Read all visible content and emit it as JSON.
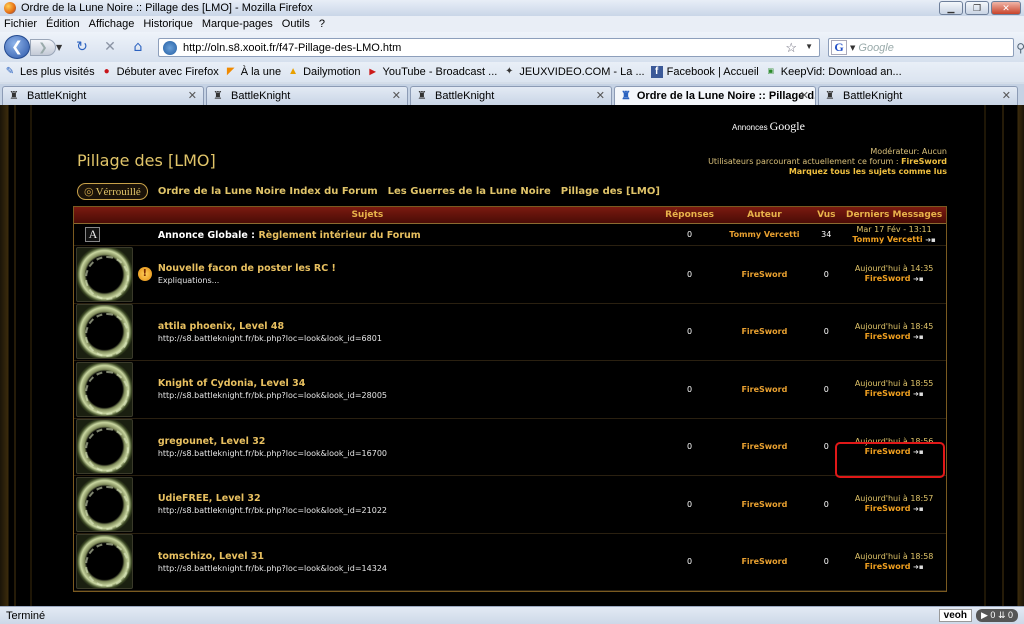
{
  "window": {
    "title": "Ordre de la Lune Noire :: Pillage des [LMO] - Mozilla Firefox"
  },
  "menu": [
    "Fichier",
    "Édition",
    "Affichage",
    "Historique",
    "Marque-pages",
    "Outils",
    "?"
  ],
  "nav": {
    "url": "http://oln.s8.xooit.fr/f47-Pillage-des-LMO.htm",
    "search_placeholder": "Google"
  },
  "bookmarks": [
    {
      "label": "Les plus visités",
      "icon": "most-visited-icon"
    },
    {
      "label": "Débuter avec Firefox",
      "icon": "firefox-icon"
    },
    {
      "label": "À la une",
      "icon": "rss-icon"
    },
    {
      "label": "Dailymotion",
      "icon": "dailymotion-icon"
    },
    {
      "label": "YouTube - Broadcast ...",
      "icon": "youtube-icon"
    },
    {
      "label": "JEUXVIDEO.COM - La ...",
      "icon": "jeuxvideo-icon"
    },
    {
      "label": "Facebook | Accueil",
      "icon": "facebook-icon"
    },
    {
      "label": "KeepVid: Download an...",
      "icon": "keepvid-icon"
    }
  ],
  "tabs": [
    {
      "label": "BattleKnight",
      "active": false
    },
    {
      "label": "BattleKnight",
      "active": false
    },
    {
      "label": "BattleKnight",
      "active": false
    },
    {
      "label": "Ordre de la Lune Noire :: Pillage d...",
      "active": true
    },
    {
      "label": "BattleKnight",
      "active": false
    }
  ],
  "page": {
    "ads_label": "Annonces",
    "ads_brand": "Google",
    "forum_title": "Pillage des [LMO]",
    "moderator": "Modérateur: Aucun",
    "users_browsing_label": "Utilisateurs parcourant actuellement ce forum :",
    "users_browsing_name": "FireSword",
    "mark_read": "Marquez tous les sujets comme lus",
    "locked_label": "Vérrouillé",
    "breadcrumbs": [
      "Ordre de la Lune Noire Index du Forum",
      "Les Guerres de la Lune Noire",
      "Pillage des [LMO]"
    ],
    "columns": {
      "subjects": "Sujets",
      "replies": "Réponses",
      "author": "Auteur",
      "views": "Vus",
      "last": "Derniers Messages"
    },
    "announcement": {
      "label": "Annonce Globale :",
      "title": "Règlement intérieur du Forum",
      "replies": "0",
      "author": "Tommy Vercetti",
      "views": "34",
      "last_date": "Mar 17 Fév - 13:11",
      "last_by": "Tommy Vercetti"
    },
    "topics": [
      {
        "title": "Nouvelle facon de poster les RC !",
        "sub": "Expliquations...",
        "replies": "0",
        "author": "FireSword",
        "views": "0",
        "last_date": "Aujourd'hui à 14:35",
        "last_by": "FireSword"
      },
      {
        "title": "attila phoenix, Level 48",
        "sub": "http://s8.battleknight.fr/bk.php?loc=look&look_id=6801",
        "replies": "0",
        "author": "FireSword",
        "views": "0",
        "last_date": "Aujourd'hui à 18:45",
        "last_by": "FireSword"
      },
      {
        "title": "Knight of Cydonia, Level 34",
        "sub": "http://s8.battleknight.fr/bk.php?loc=look&look_id=28005",
        "replies": "0",
        "author": "FireSword",
        "views": "0",
        "last_date": "Aujourd'hui à 18:55",
        "last_by": "FireSword"
      },
      {
        "title": "gregounet, Level 32",
        "sub": "http://s8.battleknight.fr/bk.php?loc=look&look_id=16700",
        "replies": "0",
        "author": "FireSword",
        "views": "0",
        "last_date": "Aujourd'hui à 18:56",
        "last_by": "FireSword"
      },
      {
        "title": "UdieFREE, Level 32",
        "sub": "http://s8.battleknight.fr/bk.php?loc=look&look_id=21022",
        "replies": "0",
        "author": "FireSword",
        "views": "0",
        "last_date": "Aujourd'hui à 18:57",
        "last_by": "FireSword"
      },
      {
        "title": "tomschizo, Level 31",
        "sub": "http://s8.battleknight.fr/bk.php?loc=look&look_id=14324",
        "replies": "0",
        "author": "FireSword",
        "views": "0",
        "last_date": "Aujourd'hui à 18:58",
        "last_by": "FireSword"
      }
    ]
  },
  "status": {
    "text": "Terminé",
    "addon": "veoh",
    "counter1": "0",
    "counter2": "0"
  }
}
